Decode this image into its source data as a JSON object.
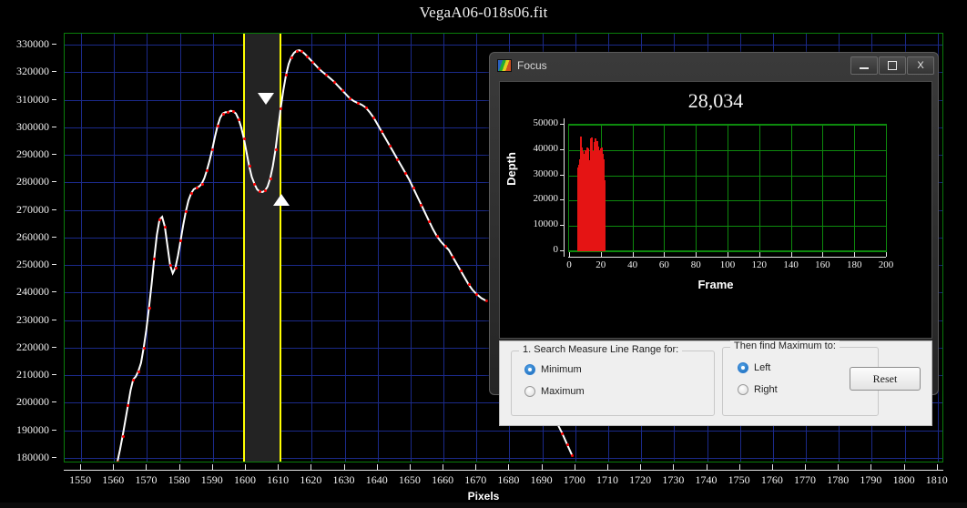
{
  "window": {
    "title": "VegaA06-018s06.fit"
  },
  "chart_data": {
    "type": "line",
    "title": "VegaA06-018s06.fit",
    "xlabel": "Pixels",
    "ylabel": "",
    "xlim": [
      1545,
      1812
    ],
    "ylim": [
      178000,
      334000
    ],
    "xticks": [
      1550,
      1560,
      1570,
      1580,
      1590,
      1600,
      1610,
      1620,
      1630,
      1640,
      1650,
      1660,
      1670,
      1680,
      1690,
      1700,
      1710,
      1720,
      1730,
      1740,
      1750,
      1760,
      1770,
      1780,
      1790,
      1800,
      1810
    ],
    "yticks": [
      180000,
      190000,
      200000,
      210000,
      220000,
      230000,
      240000,
      250000,
      260000,
      270000,
      280000,
      290000,
      300000,
      310000,
      320000,
      330000
    ],
    "grid": true,
    "line_color": "#ffffff",
    "marker_color": "#ff0000",
    "grid_color": "#1b2a8a",
    "border_color": "#0a7d0a",
    "measure_lines": {
      "color": "#ffff00",
      "left_x": 1599.5,
      "right_x": 1610.5,
      "band_color": "#232323"
    },
    "markers": [
      {
        "name": "maximum-marker",
        "shape": "triangle-down",
        "x": 1606.1,
        "y": 307500
      },
      {
        "name": "minimum-marker",
        "shape": "triangle-up",
        "x": 1610.8,
        "y": 276500
      }
    ],
    "x": [
      1561.0,
      1561.8,
      1562.6,
      1563.4,
      1564.2,
      1565.0,
      1565.8,
      1566.6,
      1567.4,
      1568.2,
      1569.0,
      1569.8,
      1570.6,
      1571.4,
      1572.2,
      1573.0,
      1573.8,
      1574.6,
      1575.4,
      1576.2,
      1577.0,
      1577.8,
      1578.6,
      1579.4,
      1580.2,
      1581.0,
      1581.8,
      1582.6,
      1583.4,
      1584.2,
      1585.0,
      1585.8,
      1586.6,
      1587.4,
      1588.2,
      1589.0,
      1589.8,
      1590.6,
      1591.4,
      1592.2,
      1593.0,
      1593.8,
      1594.6,
      1595.4,
      1596.2,
      1597.0,
      1597.8,
      1598.6,
      1599.4,
      1600.2,
      1601.0,
      1601.8,
      1602.6,
      1603.4,
      1604.2,
      1605.0,
      1605.8,
      1606.6,
      1607.4,
      1608.2,
      1609.0,
      1609.8,
      1610.6,
      1611.4,
      1612.2,
      1613.0,
      1613.8,
      1614.6,
      1615.4,
      1616.2,
      1617.0,
      1617.8,
      1618.6,
      1619.4,
      1620.2,
      1621.0,
      1622.0,
      1623.2,
      1624.4,
      1625.6,
      1626.8,
      1628.0,
      1629.2,
      1630.4,
      1631.6,
      1632.8,
      1634.0,
      1635.2,
      1636.4,
      1637.6,
      1638.8,
      1640.0,
      1641.2,
      1642.4,
      1643.6,
      1644.8,
      1646.0,
      1647.2,
      1648.4,
      1649.6,
      1650.8,
      1652.0,
      1653.2,
      1654.4,
      1655.6,
      1656.8,
      1658.0,
      1659.2,
      1660.4,
      1661.6,
      1662.8,
      1664.0,
      1665.2,
      1666.4,
      1667.6,
      1668.8,
      1670.0,
      1671.5,
      1673.0,
      1690.0,
      1691.5,
      1693.0,
      1694.5,
      1696.0,
      1697.5,
      1699.0
    ],
    "y": [
      178500,
      183000,
      188000,
      193500,
      199000,
      204500,
      208500,
      209500,
      211500,
      214500,
      220000,
      226500,
      234500,
      243000,
      252500,
      261000,
      266500,
      267500,
      264000,
      257000,
      250000,
      247000,
      249000,
      253500,
      259000,
      264500,
      269500,
      273500,
      276000,
      277500,
      278000,
      278500,
      279500,
      281500,
      284500,
      288000,
      292000,
      296500,
      300500,
      303500,
      305000,
      305500,
      305500,
      306000,
      305800,
      305000,
      303000,
      300000,
      296000,
      291000,
      286000,
      282000,
      279500,
      277500,
      276700,
      276500,
      277000,
      278500,
      281500,
      286000,
      292000,
      299500,
      307000,
      313500,
      319000,
      323000,
      325500,
      327000,
      327800,
      328000,
      327600,
      326800,
      325800,
      324800,
      323800,
      322800,
      321500,
      320200,
      319000,
      317800,
      316500,
      315000,
      313500,
      312000,
      310500,
      309500,
      308800,
      308200,
      307200,
      305500,
      303500,
      301000,
      298500,
      296000,
      293500,
      291000,
      288500,
      286000,
      283500,
      281000,
      278000,
      275000,
      272000,
      269000,
      266000,
      263000,
      260500,
      258500,
      257000,
      255500,
      253000,
      250500,
      248000,
      245500,
      243000,
      241000,
      239500,
      238000,
      237000,
      203000,
      199500,
      196000,
      192500,
      189000,
      185000,
      181000
    ]
  },
  "focus_dialog": {
    "title": "Focus",
    "icon": "chart-icon",
    "value": "28,034",
    "window_buttons": [
      {
        "name": "minimize-button",
        "glyph": "minimize-icon"
      },
      {
        "name": "maximize-button",
        "glyph": "maximize-icon"
      },
      {
        "name": "close-button",
        "glyph": "close-icon",
        "label": "X"
      }
    ],
    "mini_chart": {
      "type": "bar",
      "xlabel": "Frame",
      "ylabel": "Depth",
      "xlim": [
        0,
        200
      ],
      "ylim": [
        0,
        50000
      ],
      "xticks": [
        0,
        20,
        40,
        60,
        80,
        100,
        120,
        140,
        160,
        180,
        200
      ],
      "yticks": [
        0,
        10000,
        20000,
        30000,
        40000,
        50000
      ],
      "grid_color": "#0d8a0d",
      "bar_color": "#e51414",
      "categories": [
        5,
        6,
        6.5,
        7,
        7.5,
        8,
        8.5,
        9,
        9.5,
        10,
        10.5,
        11,
        11.5,
        12,
        12.5,
        13,
        13.5,
        14,
        14.5,
        15,
        15.5,
        16,
        16.5,
        17,
        17.5,
        18,
        18.5,
        19,
        19.5,
        20,
        20.5,
        21,
        21.5,
        22
      ],
      "values": [
        33000,
        34000,
        36500,
        45500,
        41000,
        39500,
        33500,
        38500,
        40000,
        37000,
        39000,
        41000,
        40500,
        34500,
        36000,
        41500,
        44500,
        45000,
        38000,
        39500,
        43000,
        44500,
        42000,
        40500,
        43500,
        41500,
        40000,
        38000,
        40500,
        41000,
        38500,
        36500,
        33000,
        28000
      ]
    },
    "controls": {
      "group1_title": "1. Search Measure Line Range for:",
      "group1_options": [
        {
          "label": "Minimum",
          "selected": true
        },
        {
          "label": "Maximum",
          "selected": false
        }
      ],
      "group2_title": "Then find Maximum to:",
      "group2_options": [
        {
          "label": "Left",
          "selected": true
        },
        {
          "label": "Right",
          "selected": false
        }
      ],
      "reset_label": "Reset"
    }
  }
}
